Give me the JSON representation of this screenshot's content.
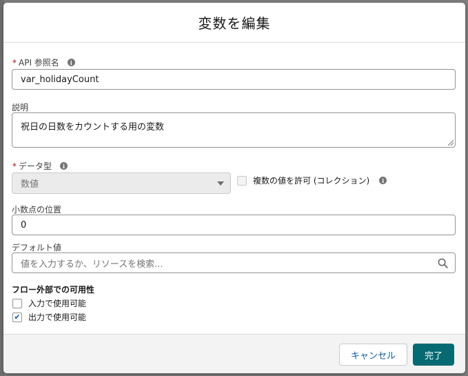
{
  "dialog": {
    "title": "変数を編集"
  },
  "fields": {
    "api_name": {
      "required_marker": "*",
      "label": "API 参照名",
      "value": "var_holidayCount"
    },
    "description": {
      "label": "説明",
      "value": "祝日の日数をカウントする用の変数"
    },
    "data_type": {
      "required_marker": "*",
      "label": "データ型",
      "value": "数値"
    },
    "allow_multiple": {
      "label": "複数の値を許可 (コレクション)",
      "checked": false
    },
    "decimal_places": {
      "label": "小数点の位置",
      "value": "0"
    },
    "default_value": {
      "label": "デフォルト値",
      "placeholder": "値を入力するか、リソースを検索..."
    }
  },
  "availability": {
    "title": "フロー外部での可用性",
    "input": {
      "label": "入力で使用可能",
      "checked": false
    },
    "output": {
      "label": "出力で使用可能",
      "checked": true
    }
  },
  "footer": {
    "cancel_label": "キャンセル",
    "done_label": "完了"
  },
  "icons": {
    "info": "info-icon",
    "search": "search-icon",
    "dropdown": "chevron-down-icon",
    "check": "✔"
  },
  "colors": {
    "brand_button": "#066a73",
    "required": "#ba0517",
    "link_text": "#0b5cab"
  }
}
